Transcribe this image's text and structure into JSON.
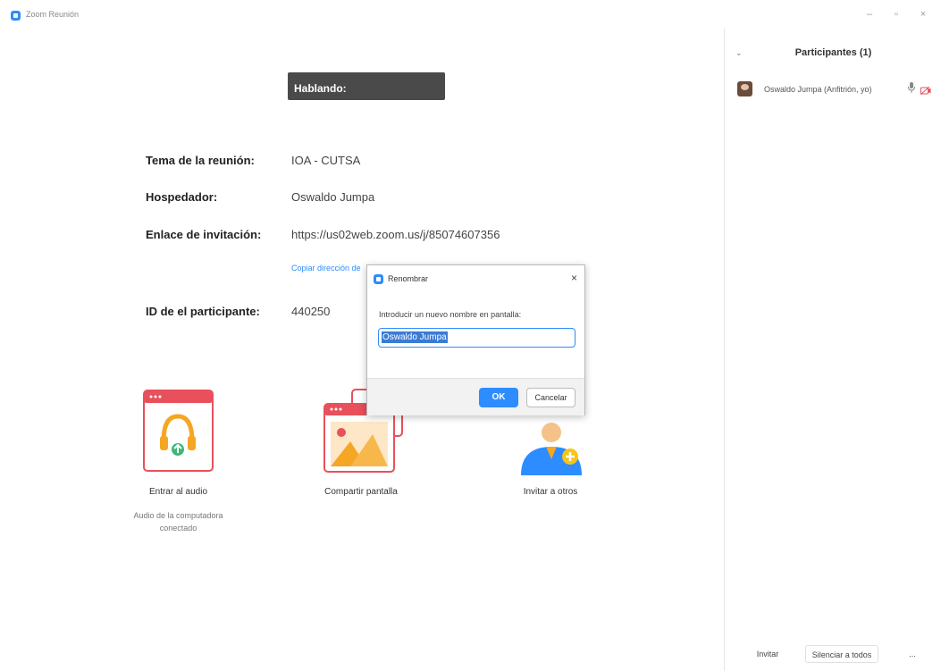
{
  "window": {
    "title": "Zoom Reunión",
    "minimize": "–",
    "restore": "▫",
    "close": "×"
  },
  "speaking_bar": {
    "label": "Hablando:"
  },
  "meeting_info": {
    "topic_label": "Tema de la reunión:",
    "topic_value": "IOA - CUTSA",
    "host_label": "Hospedador:",
    "host_value": "Oswaldo Jumpa",
    "invite_label": "Enlace de invitación:",
    "invite_value": "https://us02web.zoom.us/j/85074607356",
    "copy_link": "Copiar dirección de",
    "participant_id_label": "ID de el participante:",
    "participant_id_value": "440250"
  },
  "tiles": {
    "audio": {
      "label": "Entrar al audio",
      "sub": "Audio de la computadora conectado",
      "icon": "headphones-icon",
      "accent": "#e8505b"
    },
    "share": {
      "label": "Compartir pantalla",
      "icon": "share-screen-icon",
      "accent": "#e8505b"
    },
    "invite": {
      "label": "Invitar a otros",
      "icon": "invite-person-icon",
      "accent": "#2d8cff"
    }
  },
  "dialog": {
    "title": "Renombrar",
    "close": "×",
    "prompt": "Introducir un nuevo nombre en pantalla:",
    "input_value": "Oswaldo Jumpa",
    "ok": "OK",
    "cancel": "Cancelar"
  },
  "participants": {
    "collapse": "⌄",
    "title": "Participantes (1)",
    "rows": [
      {
        "name": "Oswaldo Jumpa (Anfitrión, yo)"
      }
    ],
    "invite_button": "Invitar",
    "mute_all_button": "Silenciar a todos",
    "more_button": "..."
  },
  "colors": {
    "accent_blue": "#2d8cff",
    "red": "#e8505b",
    "speaking_bg": "#4a4a4a"
  }
}
